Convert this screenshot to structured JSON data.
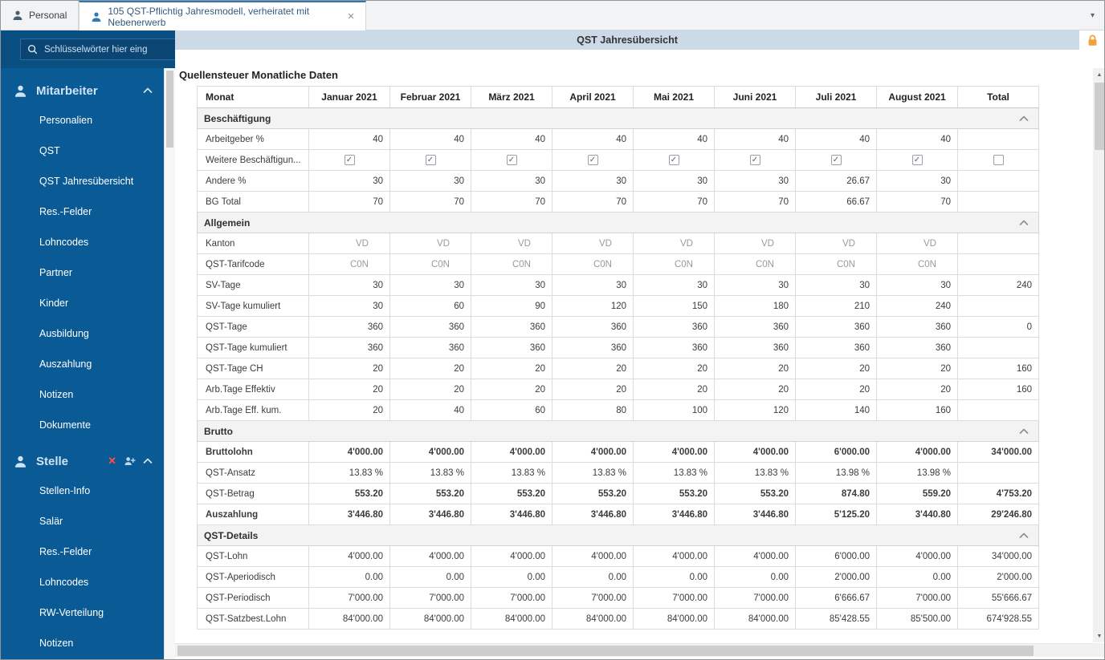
{
  "window": {
    "tabs": [
      {
        "label": "Personal",
        "icon": "person-icon",
        "active": false
      },
      {
        "label": "105 QST-Pflichtig Jahresmodell, verheiratet mit Nebenerwerb",
        "icon": "person-icon",
        "active": true,
        "close_icon": "×"
      }
    ],
    "tabbar_caret": "▾"
  },
  "sidebar": {
    "search_placeholder": "Schlüsselwörter hier eing",
    "sections": [
      {
        "label": "Mitarbeiter",
        "icon": "person-icon",
        "trailing_icons": [
          "chevron-up-icon"
        ],
        "items": [
          "Personalien",
          "QST",
          "QST Jahresübersicht",
          "Res.-Felder",
          "Lohncodes",
          "Partner",
          "Kinder",
          "Ausbildung",
          "Auszahlung",
          "Notizen",
          "Dokumente"
        ]
      },
      {
        "label": "Stelle",
        "icon": "person-icon",
        "trailing_icons": [
          "remove-icon",
          "assign-icon",
          "chevron-up-icon"
        ],
        "items": [
          "Stellen-Info",
          "Salär",
          "Res.-Felder",
          "Lohncodes",
          "RW-Verteilung",
          "Notizen"
        ]
      }
    ]
  },
  "header": {
    "title": "QST Jahresübersicht",
    "lock_icon_color": "#f0a13a"
  },
  "content": {
    "title": "Quellensteuer Monatliche Daten"
  },
  "table": {
    "columns": [
      "Monat",
      "Januar 2021",
      "Februar 2021",
      "März 2021",
      "April 2021",
      "Mai 2021",
      "Juni 2021",
      "Juli 2021",
      "August 2021",
      "Total"
    ],
    "sections": [
      {
        "label": "Beschäftigung",
        "rows": [
          {
            "label": "Arbeitgeber %",
            "type": "number",
            "values": [
              "40",
              "40",
              "40",
              "40",
              "40",
              "40",
              "40",
              "40",
              ""
            ]
          },
          {
            "label": "Weitere Beschäftigun...",
            "type": "checkbox",
            "values": [
              true,
              true,
              true,
              true,
              true,
              true,
              true,
              true,
              false
            ]
          },
          {
            "label": "Andere %",
            "type": "number",
            "values": [
              "30",
              "30",
              "30",
              "30",
              "30",
              "30",
              "26.67",
              "30",
              ""
            ]
          },
          {
            "label": "BG Total",
            "type": "number",
            "values": [
              "70",
              "70",
              "70",
              "70",
              "70",
              "70",
              "66.67",
              "70",
              ""
            ]
          }
        ]
      },
      {
        "label": "Allgemein",
        "rows": [
          {
            "label": "Kanton",
            "type": "muted",
            "values": [
              "VD",
              "VD",
              "VD",
              "VD",
              "VD",
              "VD",
              "VD",
              "VD",
              ""
            ]
          },
          {
            "label": "QST-Tarifcode",
            "type": "muted",
            "values": [
              "C0N",
              "C0N",
              "C0N",
              "C0N",
              "C0N",
              "C0N",
              "C0N",
              "C0N",
              ""
            ]
          },
          {
            "label": "SV-Tage",
            "type": "number",
            "values": [
              "30",
              "30",
              "30",
              "30",
              "30",
              "30",
              "30",
              "30",
              "240"
            ]
          },
          {
            "label": "SV-Tage kumuliert",
            "type": "number",
            "values": [
              "30",
              "60",
              "90",
              "120",
              "150",
              "180",
              "210",
              "240",
              ""
            ]
          },
          {
            "label": "QST-Tage",
            "type": "number",
            "values": [
              "360",
              "360",
              "360",
              "360",
              "360",
              "360",
              "360",
              "360",
              "0"
            ]
          },
          {
            "label": "QST-Tage kumuliert",
            "type": "number",
            "values": [
              "360",
              "360",
              "360",
              "360",
              "360",
              "360",
              "360",
              "360",
              ""
            ]
          },
          {
            "label": "QST-Tage CH",
            "type": "number",
            "values": [
              "20",
              "20",
              "20",
              "20",
              "20",
              "20",
              "20",
              "20",
              "160"
            ]
          },
          {
            "label": "Arb.Tage Effektiv",
            "type": "number",
            "values": [
              "20",
              "20",
              "20",
              "20",
              "20",
              "20",
              "20",
              "20",
              "160"
            ]
          },
          {
            "label": "Arb.Tage Eff. kum.",
            "type": "number",
            "values": [
              "20",
              "40",
              "60",
              "80",
              "100",
              "120",
              "140",
              "160",
              ""
            ]
          }
        ]
      },
      {
        "label": "Brutto",
        "rows": [
          {
            "label": "Bruttolohn",
            "type": "number",
            "bold_label": true,
            "bold_values": true,
            "values": [
              "4'000.00",
              "4'000.00",
              "4'000.00",
              "4'000.00",
              "4'000.00",
              "4'000.00",
              "6'000.00",
              "4'000.00",
              "34'000.00"
            ]
          },
          {
            "label": "QST-Ansatz",
            "type": "number",
            "values": [
              "13.83 %",
              "13.83 %",
              "13.83 %",
              "13.83 %",
              "13.83 %",
              "13.83 %",
              "13.98 %",
              "13.98 %",
              ""
            ]
          },
          {
            "label": "QST-Betrag",
            "type": "number",
            "bold_values": true,
            "values": [
              "553.20",
              "553.20",
              "553.20",
              "553.20",
              "553.20",
              "553.20",
              "874.80",
              "559.20",
              "4'753.20"
            ]
          },
          {
            "label": "Auszahlung",
            "type": "number",
            "bold_label": true,
            "bold_values": true,
            "values": [
              "3'446.80",
              "3'446.80",
              "3'446.80",
              "3'446.80",
              "3'446.80",
              "3'446.80",
              "5'125.20",
              "3'440.80",
              "29'246.80"
            ]
          }
        ]
      },
      {
        "label": "QST-Details",
        "rows": [
          {
            "label": "QST-Lohn",
            "type": "number",
            "values": [
              "4'000.00",
              "4'000.00",
              "4'000.00",
              "4'000.00",
              "4'000.00",
              "4'000.00",
              "6'000.00",
              "4'000.00",
              "34'000.00"
            ]
          },
          {
            "label": "QST-Aperiodisch",
            "type": "number",
            "values": [
              "0.00",
              "0.00",
              "0.00",
              "0.00",
              "0.00",
              "0.00",
              "2'000.00",
              "0.00",
              "2'000.00"
            ]
          },
          {
            "label": "QST-Periodisch",
            "type": "number",
            "values": [
              "7'000.00",
              "7'000.00",
              "7'000.00",
              "7'000.00",
              "7'000.00",
              "7'000.00",
              "6'666.67",
              "7'000.00",
              "55'666.67"
            ]
          },
          {
            "label": "QST-Satzbest.Lohn",
            "type": "number",
            "values": [
              "84'000.00",
              "84'000.00",
              "84'000.00",
              "84'000.00",
              "84'000.00",
              "84'000.00",
              "85'428.55",
              "85'500.00",
              "674'928.55"
            ]
          }
        ]
      }
    ]
  }
}
